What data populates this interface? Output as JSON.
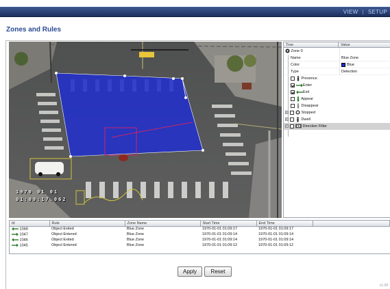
{
  "nav": {
    "view": "VIEW",
    "separator": "|",
    "setup": "SETUP"
  },
  "page": {
    "title": "Zones and Rules",
    "version": "v1.08"
  },
  "overlay": {
    "date": "1970 01 01",
    "time": "01:09:17.062"
  },
  "tree": {
    "headers": {
      "tree": "Tree",
      "value": "Value"
    },
    "zone_label": "Zone 0",
    "props": {
      "name": {
        "label": "Name",
        "value": "Blue Zone"
      },
      "color": {
        "label": "Color",
        "value": "Blue",
        "hex": "#1b2bd8"
      },
      "type": {
        "label": "Type",
        "value": "Detection"
      }
    },
    "rules": [
      {
        "label": "Presence",
        "checked": false,
        "icon": "person-icon"
      },
      {
        "label": "Enter",
        "checked": true,
        "icon": "enter-arrow-icon"
      },
      {
        "label": "Exit",
        "checked": true,
        "icon": "exit-arrow-icon"
      },
      {
        "label": "Appear",
        "checked": false,
        "icon": "appear-icon"
      },
      {
        "label": "Disappear",
        "checked": false,
        "icon": "disappear-icon"
      },
      {
        "label": "Stopped",
        "checked": false,
        "icon": "stopped-icon"
      },
      {
        "label": "Dwell",
        "checked": false,
        "icon": "dwell-icon"
      },
      {
        "label": "Direction Filter",
        "checked": false,
        "icon": "direction-icon"
      }
    ],
    "expand_glyph": "+"
  },
  "events": {
    "headers": {
      "id": "Id",
      "rule": "Rule",
      "zone": "Zone Name",
      "start": "Start Time",
      "end": "End Time"
    },
    "rows": [
      {
        "id": "1048",
        "rule": "Object Exited",
        "zone": "Blue Zone",
        "start": "1970-01-01 01:09:17",
        "end": "1970-01-01 01:09:17"
      },
      {
        "id": "1047",
        "rule": "Object Entered",
        "zone": "Blue Zone",
        "start": "1970-01-01 01:09:14",
        "end": "1970-01-01 01:09:14"
      },
      {
        "id": "1046",
        "rule": "Object Exited",
        "zone": "Blue Zone",
        "start": "1970-01-01 01:09:14",
        "end": "1970-01-01 01:09:14"
      },
      {
        "id": "1045",
        "rule": "Object Entered",
        "zone": "Blue Zone",
        "start": "1970-01-01 01:09:12",
        "end": "1970-01-01 01:09:12"
      }
    ]
  },
  "buttons": {
    "apply": "Apply",
    "reset": "Reset"
  }
}
